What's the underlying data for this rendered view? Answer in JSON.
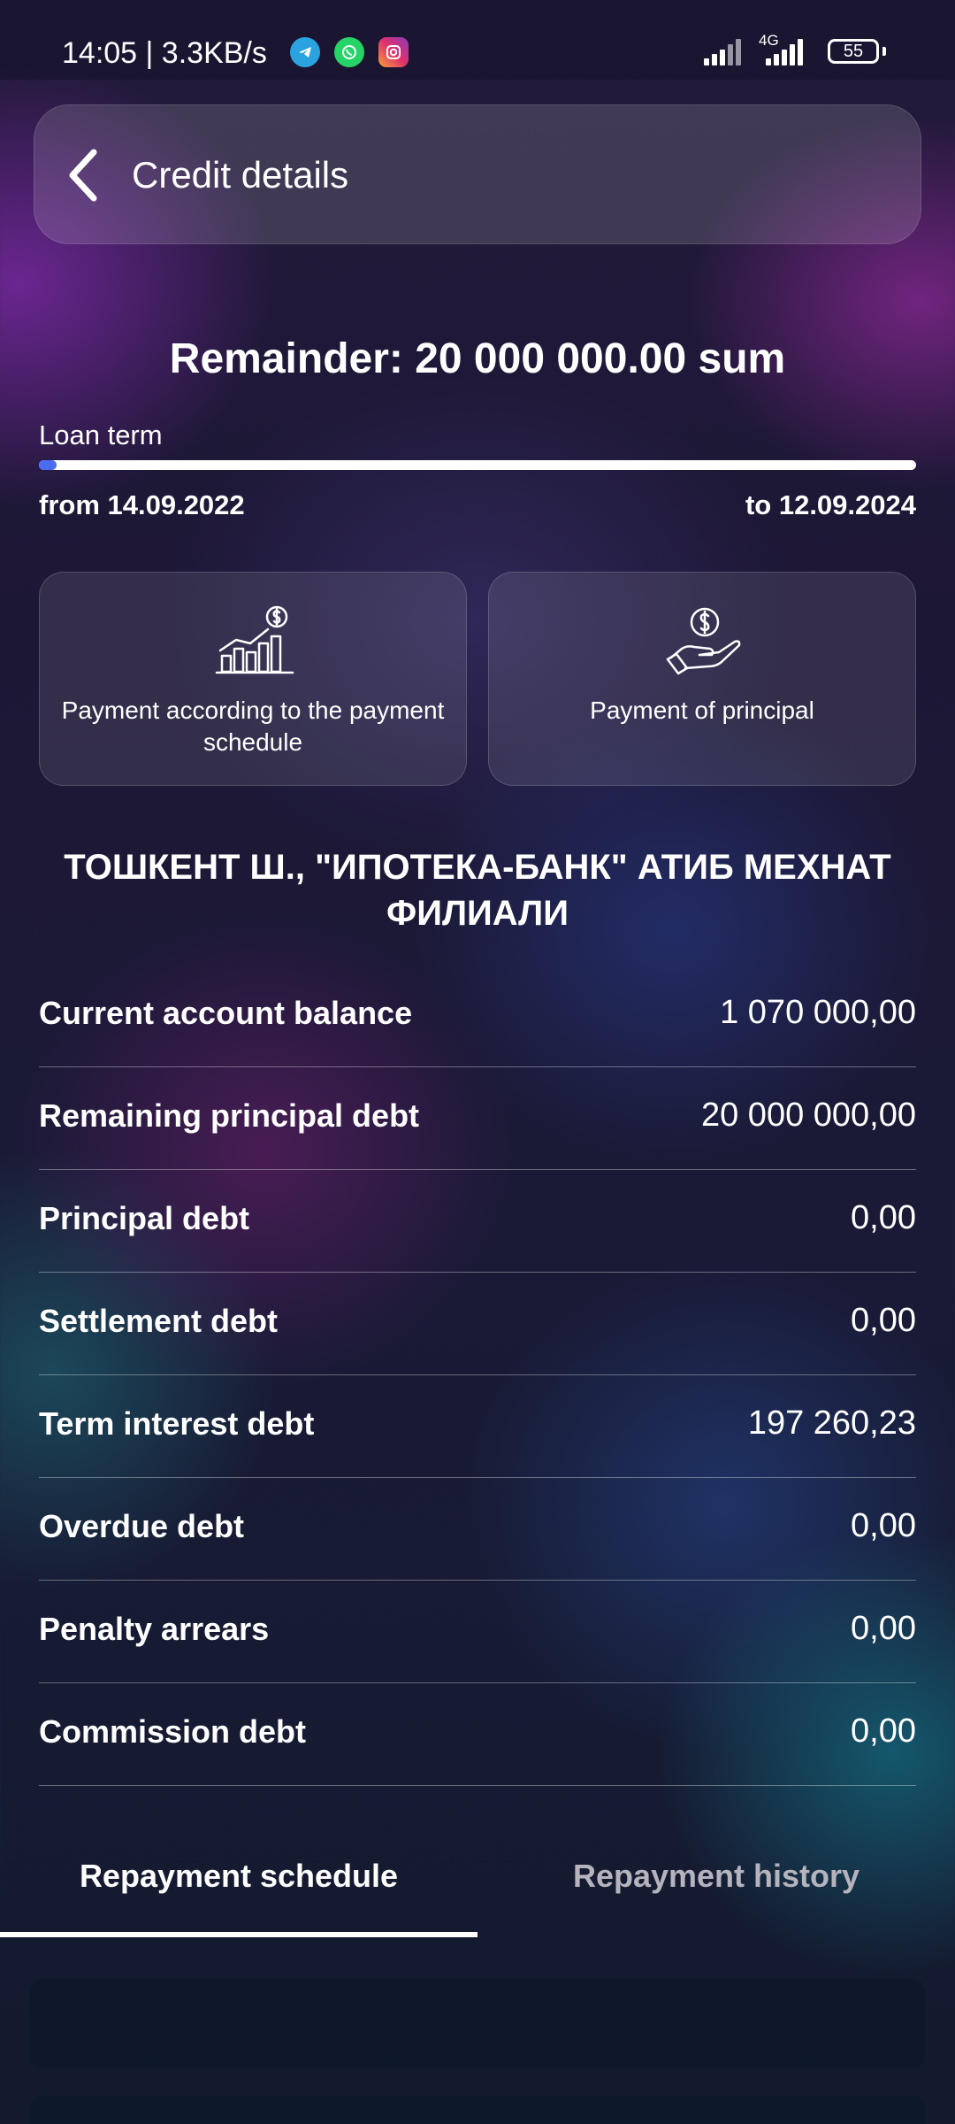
{
  "status_bar": {
    "time": "14:05 | 3.3KB/s",
    "network": "4G",
    "battery": "55"
  },
  "header": {
    "title": "Credit details"
  },
  "summary": {
    "remainder": "Remainder: 20 000 000.00 sum",
    "loan_term_label": "Loan term",
    "date_from": "from 14.09.2022",
    "date_to": "to 12.09.2024",
    "term_elapsed_fraction": 0.02
  },
  "actions": [
    {
      "label": "Payment according to the payment schedule",
      "icon": "growth-chart-dollar-icon"
    },
    {
      "label": "Payment of principal",
      "icon": "hand-dollar-icon"
    }
  ],
  "bank_name": "ТОШКЕНТ Ш., \"ИПОТЕКА-БАНК\" АТИБ МЕХНАТ ФИЛИАЛИ",
  "balances": [
    {
      "label": "Current account balance",
      "value": "1 070 000,00"
    },
    {
      "label": "Remaining principal debt",
      "value": "20 000 000,00"
    },
    {
      "label": "Principal debt",
      "value": "0,00"
    },
    {
      "label": "Settlement debt",
      "value": "0,00"
    },
    {
      "label": "Term interest debt",
      "value": "197 260,23"
    },
    {
      "label": "Overdue debt",
      "value": "0,00"
    },
    {
      "label": "Penalty arrears",
      "value": "0,00"
    },
    {
      "label": "Commission debt",
      "value": "0,00"
    }
  ],
  "tabs": [
    {
      "label": "Repayment schedule",
      "active": true
    },
    {
      "label": "Repayment history",
      "active": false
    }
  ],
  "colors": {
    "progress_fill": "#4a6cf0",
    "inactive_tab": "#b5b3bd"
  }
}
